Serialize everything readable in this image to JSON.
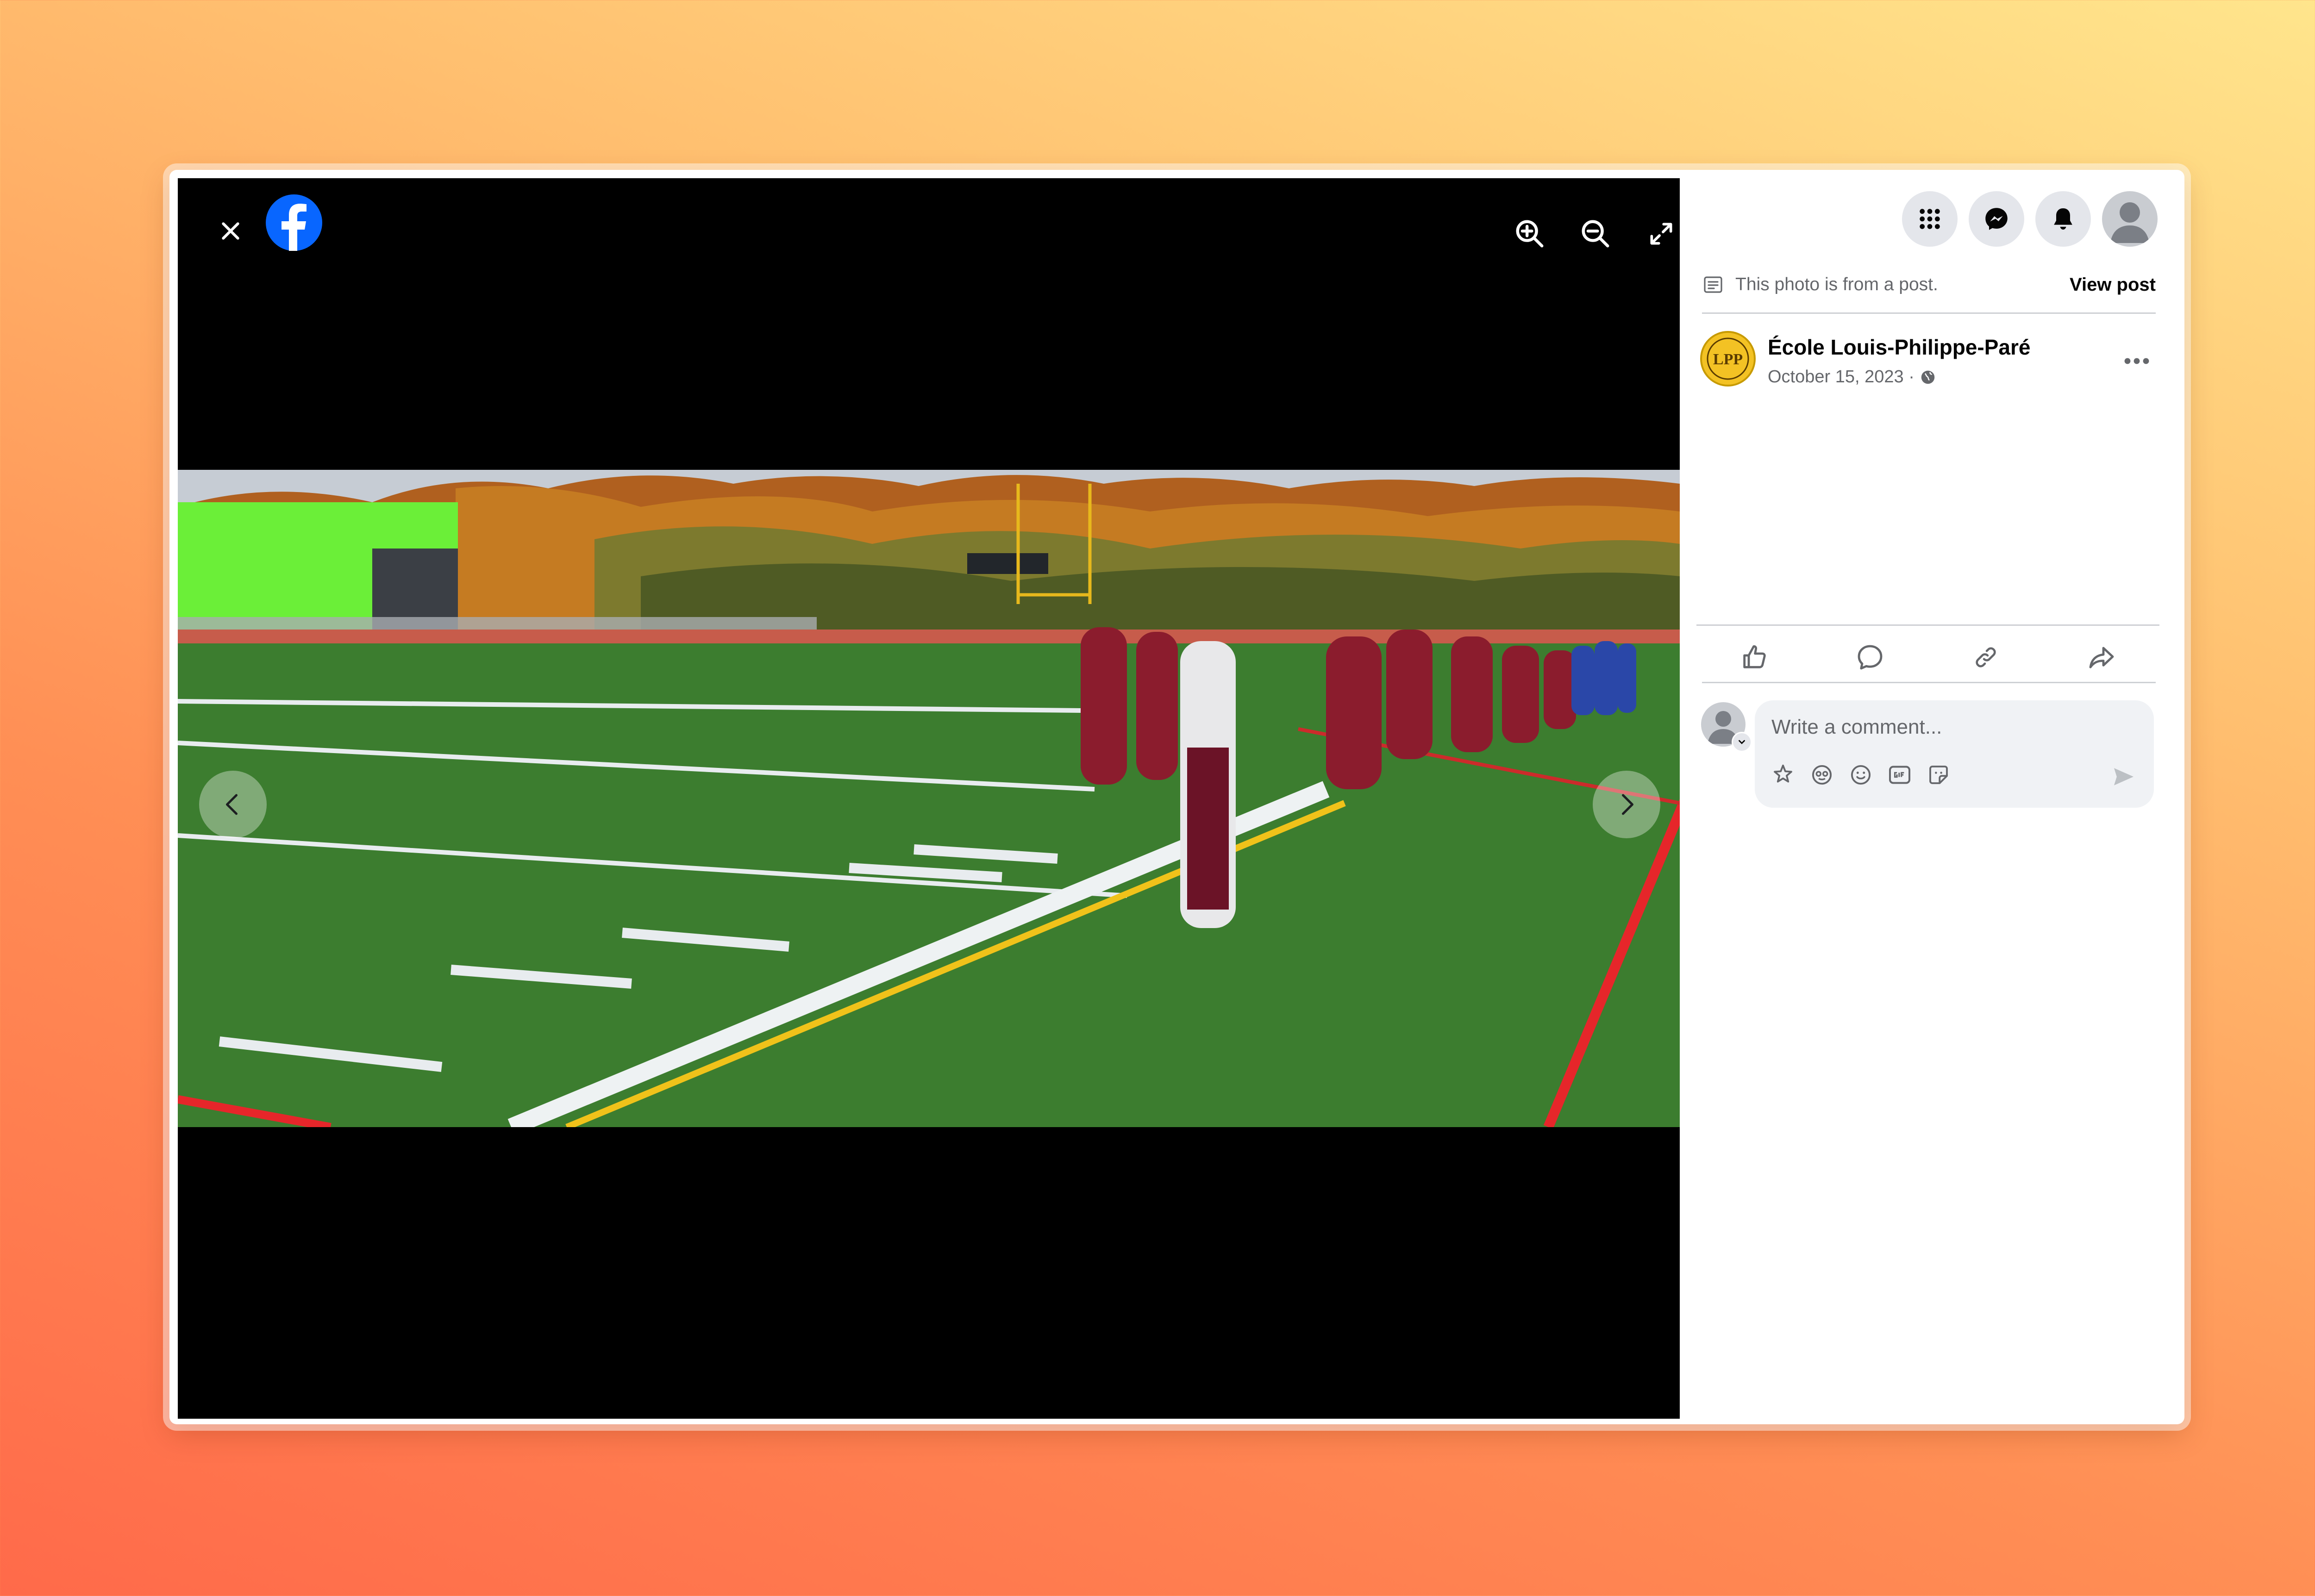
{
  "post_notice": {
    "text": "This photo is from a post.",
    "view_post_label": "View post"
  },
  "post": {
    "page_name": "École Louis-Philippe-Paré",
    "date": "October 15, 2023 ·"
  },
  "comment": {
    "placeholder": "Write a comment..."
  },
  "icons": {
    "close": "close-icon",
    "logo": "facebook-logo-icon",
    "zoom_in": "zoom-in-icon",
    "zoom_out": "zoom-out-icon",
    "fullscreen": "fullscreen-icon",
    "menu": "apps-grid-icon",
    "messenger": "messenger-icon",
    "notifications": "bell-icon",
    "profile": "avatar-icon",
    "post": "document-icon",
    "privacy": "globe-icon",
    "more": "more-dots-icon",
    "like": "thumbs-up-icon",
    "comment": "comment-bubble-icon",
    "copy_link": "link-icon",
    "share": "share-arrow-icon",
    "avatar_sticker": "avatar-sticker-icon",
    "emoji": "smiley-icon",
    "gif": "gif-icon",
    "sticker": "sticker-icon",
    "send": "send-icon"
  },
  "colors": {
    "brand": "#0866ff",
    "viewer_bg": "#000000",
    "panel_bg": "#ffffff",
    "text_secondary": "#65676b"
  }
}
